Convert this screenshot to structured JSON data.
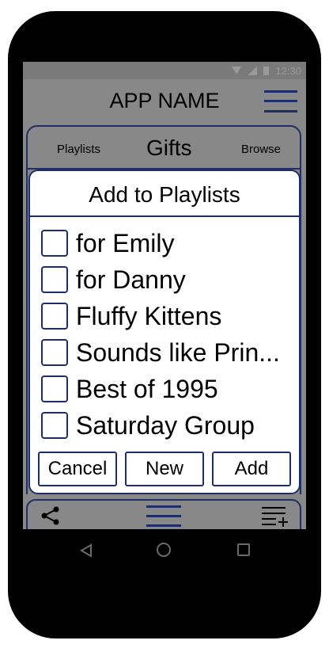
{
  "status_bar": {
    "time": "12:30",
    "icons": [
      "wifi-icon",
      "signal-icon",
      "battery-icon"
    ]
  },
  "app_bar": {
    "title": "APP NAME",
    "menu_icon": "hamburger-menu-icon"
  },
  "tabs": {
    "left": "Playlists",
    "center": "Gifts",
    "right": "Browse"
  },
  "dialog": {
    "title": "Add to Playlists",
    "playlists": [
      {
        "label": "for Emily",
        "checked": false
      },
      {
        "label": "for Danny",
        "checked": false
      },
      {
        "label": "Fluffy Kittens",
        "checked": false
      },
      {
        "label": "Sounds like Prin...",
        "checked": false
      },
      {
        "label": "Best of 1995",
        "checked": false
      },
      {
        "label": "Saturday Group",
        "checked": false
      }
    ],
    "buttons": {
      "cancel": "Cancel",
      "new": "New",
      "add": "Add"
    }
  },
  "bottom_bar": {
    "icons": [
      "share-icon",
      "menu-icon",
      "add-to-playlist-icon"
    ]
  },
  "nav_bar": {
    "icons": [
      "back-icon",
      "home-icon",
      "recent-apps-icon"
    ]
  },
  "colors": {
    "accent": "#1f2f66",
    "overlay": "#888888",
    "phone_body": "#000000"
  }
}
